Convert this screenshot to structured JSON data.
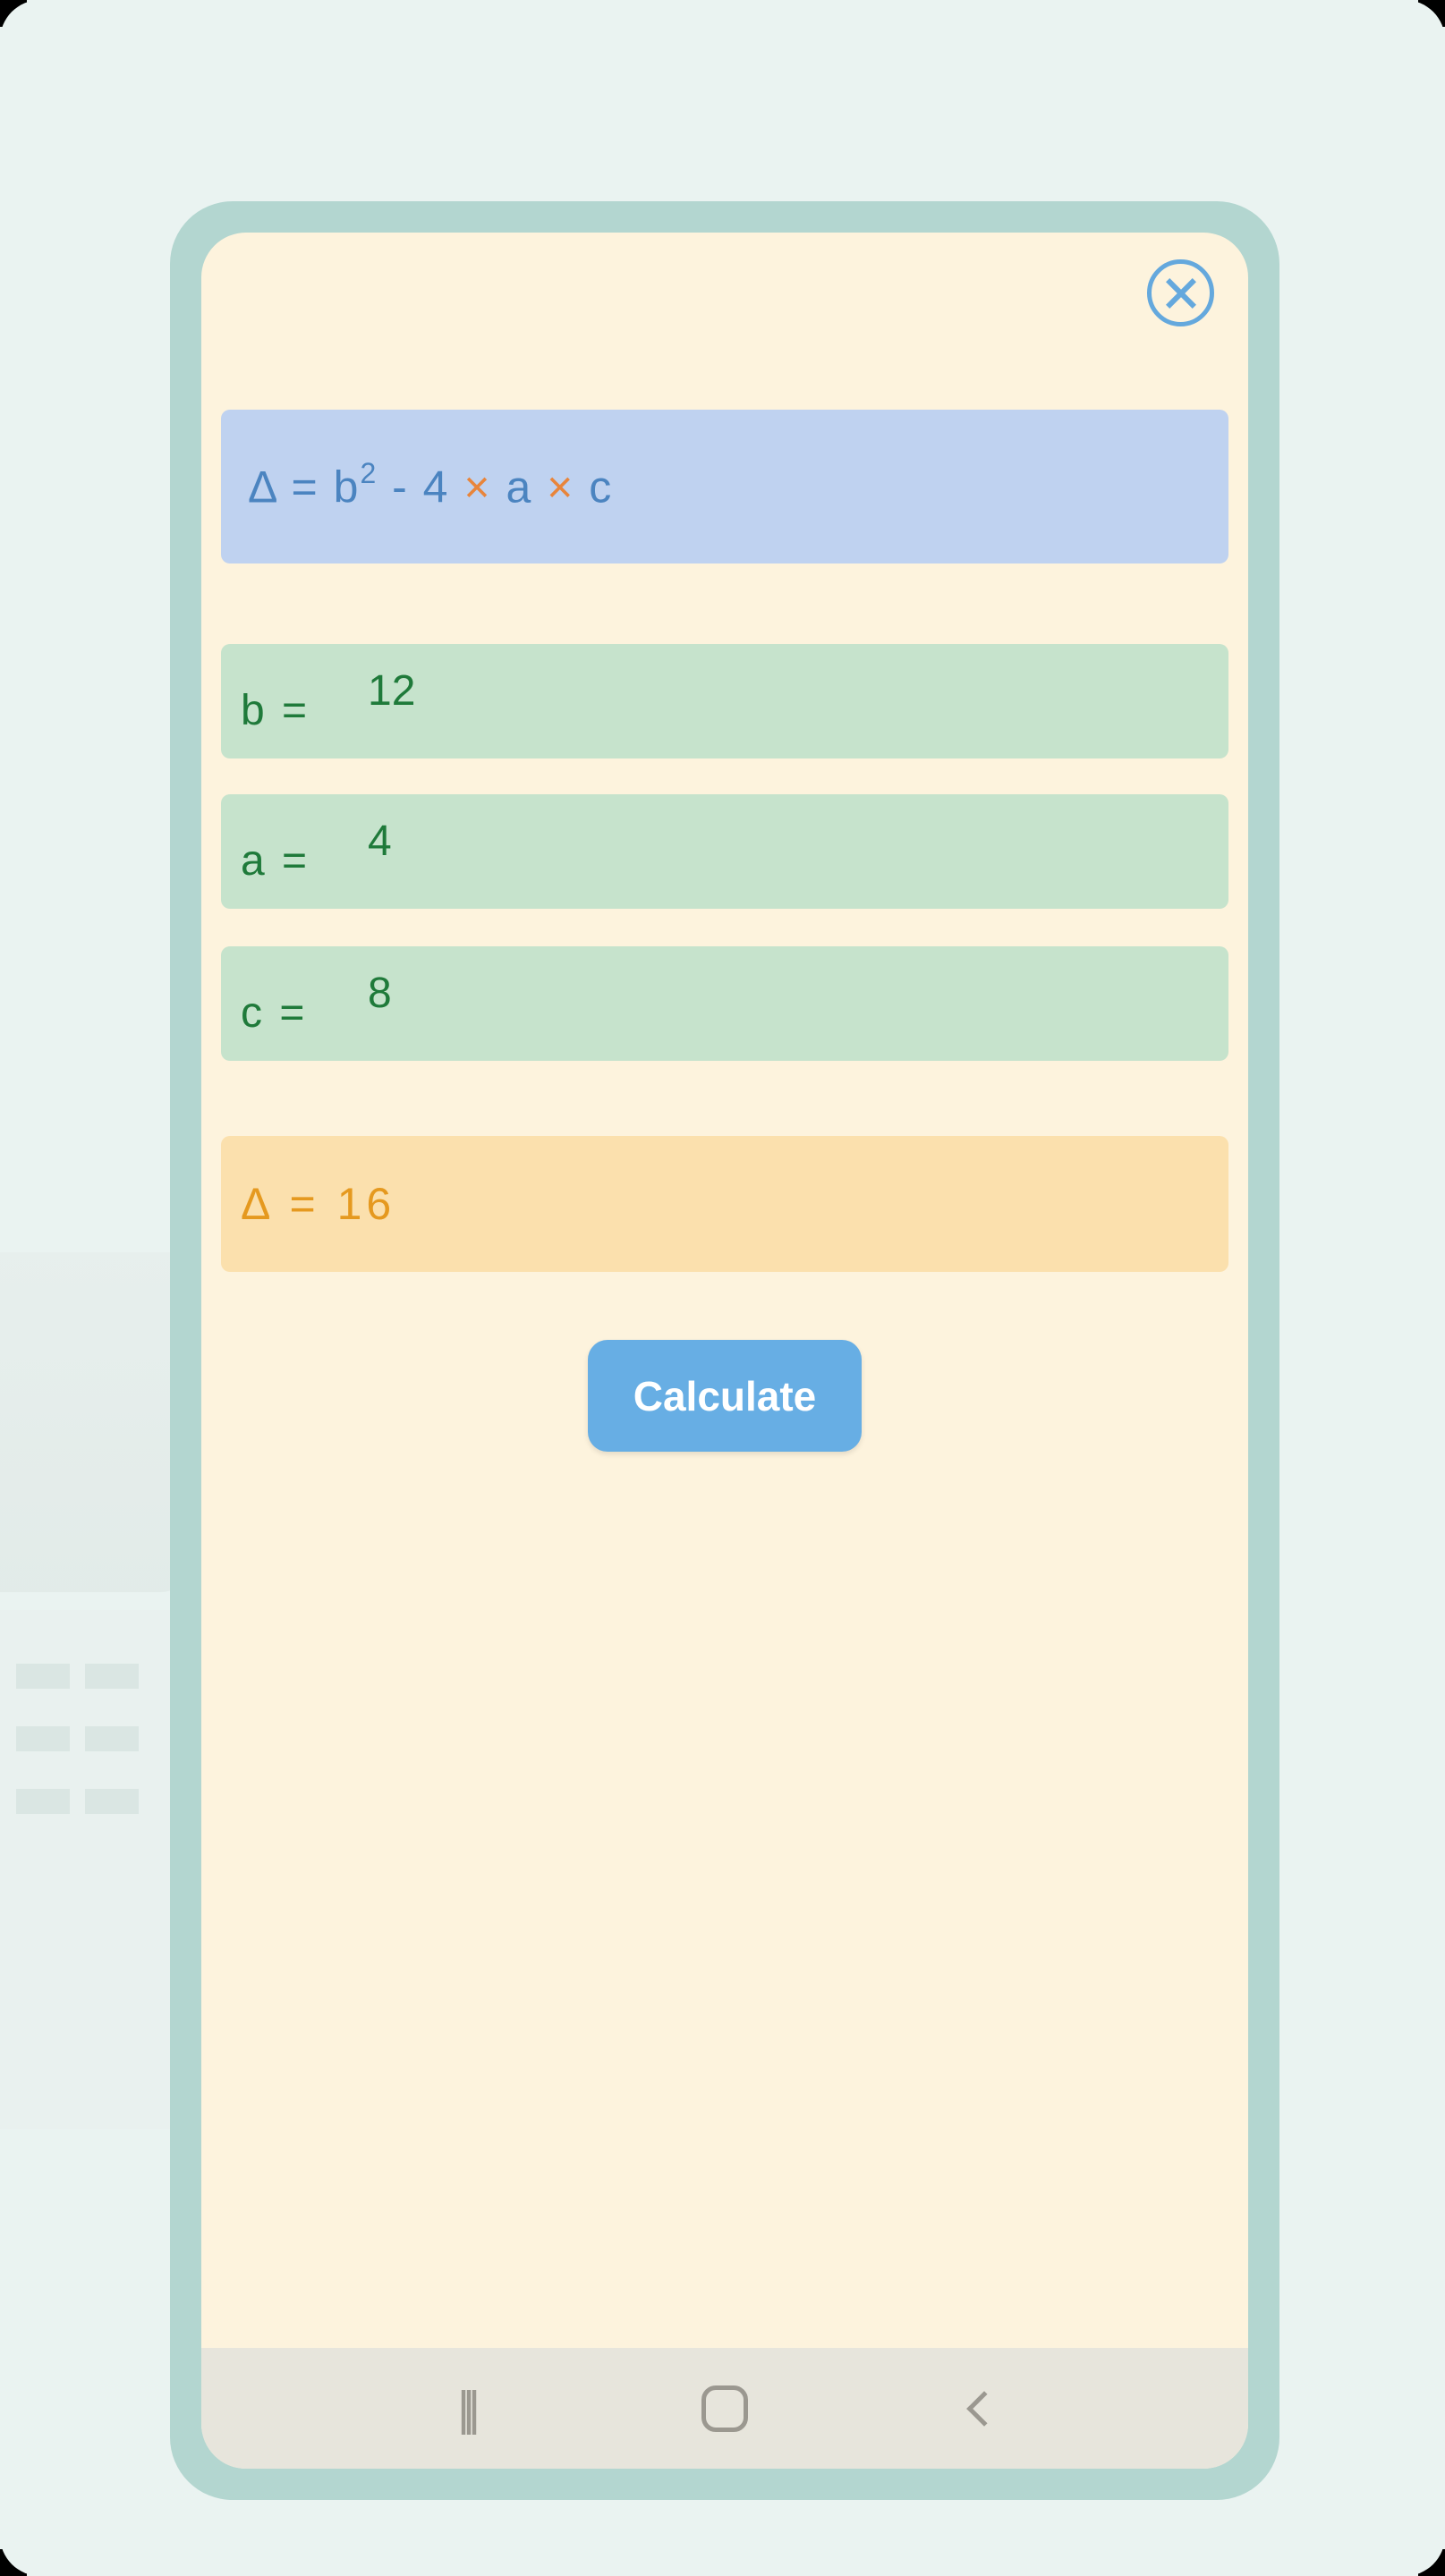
{
  "formula": {
    "delta": "Δ",
    "equals": " = ",
    "var_b": "b",
    "exp": "2",
    "minus": " - ",
    "four": "4",
    "times1": " × ",
    "var_a": "a",
    "times2": " × ",
    "var_c": "c"
  },
  "inputs": {
    "b": {
      "label": "b = ",
      "value": "12"
    },
    "a": {
      "label": "a = ",
      "value": "4"
    },
    "c": {
      "label": "c = ",
      "value": "8"
    }
  },
  "result": {
    "label": "Δ = ",
    "value": "16"
  },
  "calculate_button": "Calculate"
}
